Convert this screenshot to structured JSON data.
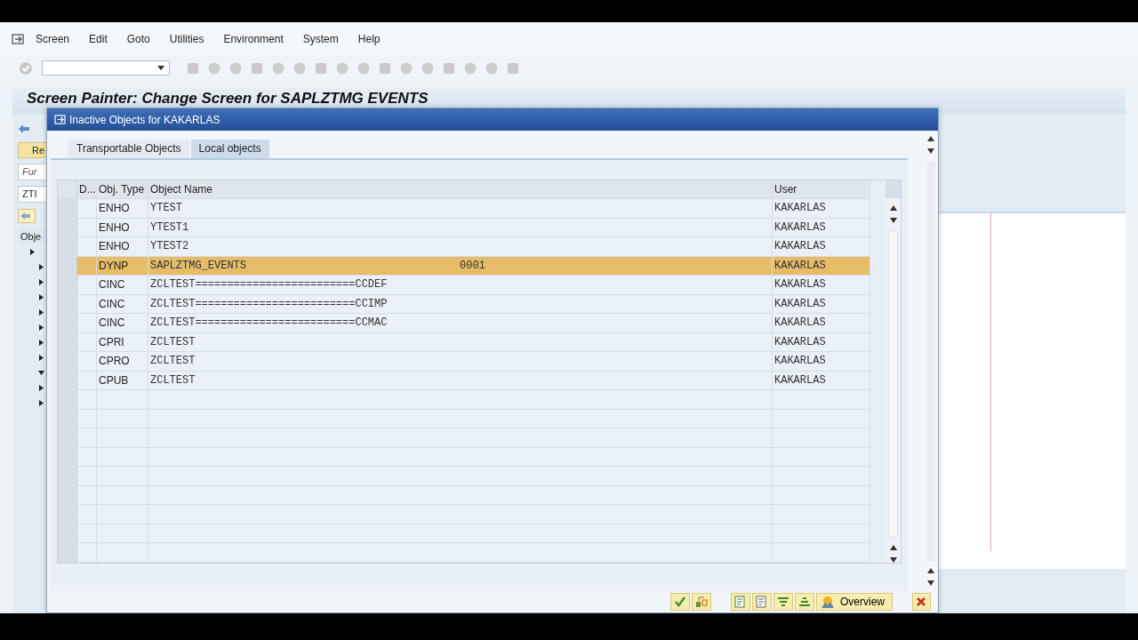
{
  "menu": [
    {
      "label": "Screen"
    },
    {
      "label": "Edit"
    },
    {
      "label": "Goto"
    },
    {
      "label": "Utilities"
    },
    {
      "label": "Environment"
    },
    {
      "label": "System"
    },
    {
      "label": "Help"
    }
  ],
  "title": "Screen Painter: Change Screen for SAPLZTMG EVENTS",
  "background_panel": {
    "button": "Re",
    "fields": [
      "Fur",
      "ZTI"
    ],
    "header": "Obje"
  },
  "dialog": {
    "title": "Inactive Objects for KAKARLAS",
    "tabs": [
      {
        "label": "Transportable Objects",
        "selected": false
      },
      {
        "label": "Local objects",
        "selected": true
      }
    ],
    "columns": [
      "D...",
      "Obj. Type",
      "Object Name",
      "User"
    ],
    "rows": [
      {
        "type": "ENHO",
        "name": "YTEST",
        "user": "KAKARLAS",
        "selected": false
      },
      {
        "type": "ENHO",
        "name": "YTEST1",
        "user": "KAKARLAS",
        "selected": false
      },
      {
        "type": "ENHO",
        "name": "YTEST2",
        "user": "KAKARLAS",
        "selected": false
      },
      {
        "type": "DYNP",
        "name": "SAPLZTMG_EVENTS",
        "extra": "0001",
        "user": "KAKARLAS",
        "selected": true
      },
      {
        "type": "CINC",
        "name": "ZCLTEST=========================CCDEF",
        "user": "KAKARLAS",
        "selected": false
      },
      {
        "type": "CINC",
        "name": "ZCLTEST=========================CCIMP",
        "user": "KAKARLAS",
        "selected": false
      },
      {
        "type": "CINC",
        "name": "ZCLTEST=========================CCMAC",
        "user": "KAKARLAS",
        "selected": false
      },
      {
        "type": "CPRI",
        "name": "ZCLTEST",
        "user": "KAKARLAS",
        "selected": false
      },
      {
        "type": "CPRO",
        "name": "ZCLTEST",
        "user": "KAKARLAS",
        "selected": false
      },
      {
        "type": "CPUB",
        "name": "ZCLTEST",
        "user": "KAKARLAS",
        "selected": false
      }
    ],
    "overview_button": "Overview"
  }
}
